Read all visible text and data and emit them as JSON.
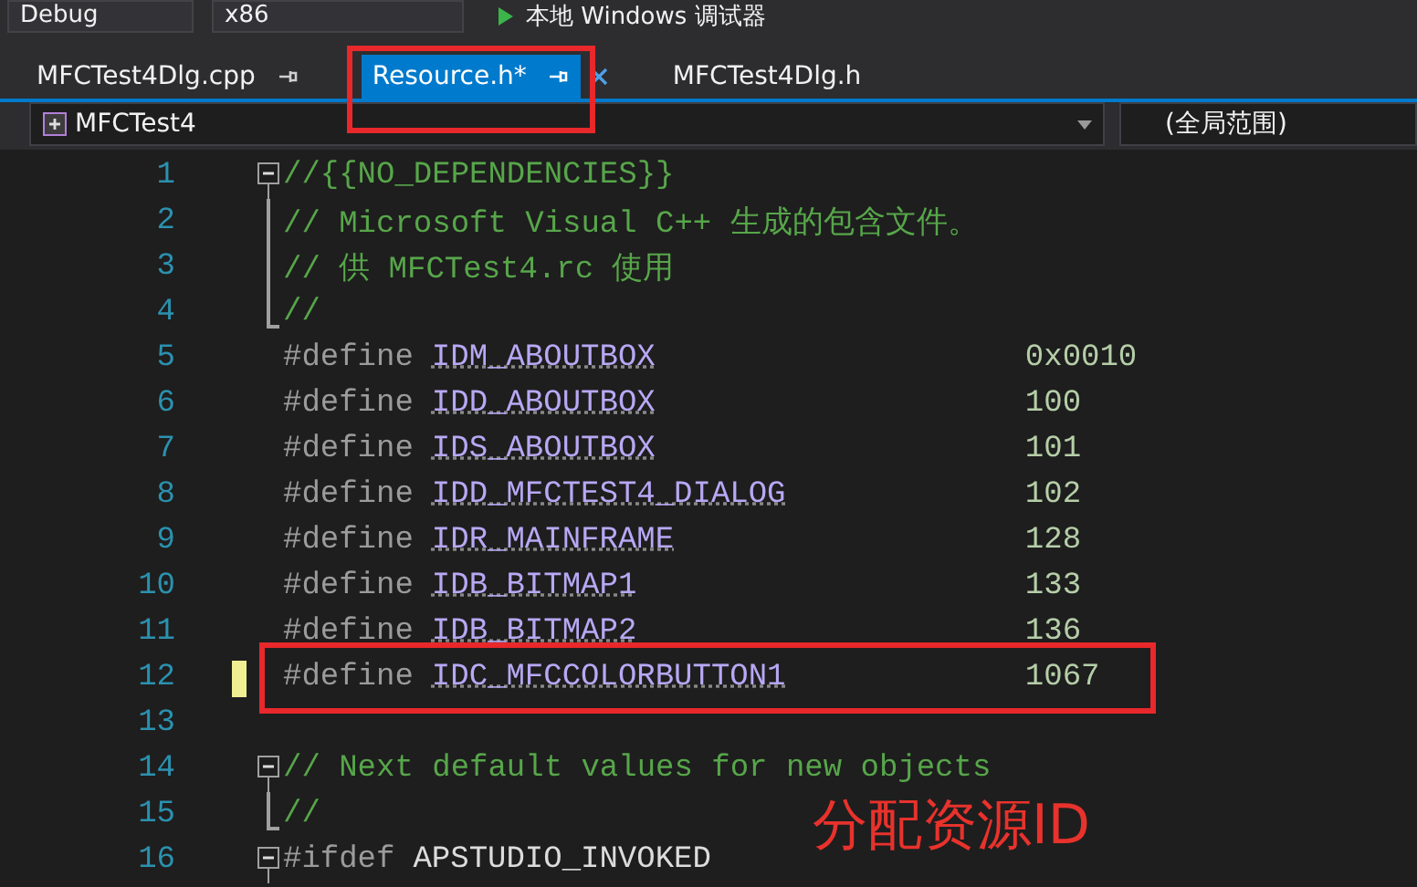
{
  "toolbar": {
    "configuration": "Debug",
    "platform": "x86",
    "debugger": "本地 Windows 调试器"
  },
  "tabs": [
    {
      "label": "MFCTest4Dlg.cpp",
      "selected": false,
      "pinned": true,
      "annotated": false
    },
    {
      "label": "Resource.h*",
      "selected": true,
      "pinned": true,
      "annotated": true
    },
    {
      "label": "MFCTest4Dlg.h",
      "selected": false,
      "pinned": false,
      "annotated": false
    }
  ],
  "navigation": {
    "project": "MFCTest4",
    "scope": "(全局范围)"
  },
  "lines": [
    {
      "number": "1",
      "kind": "comment",
      "fold_start": true,
      "text": "//{{NO_DEPENDENCIES}}"
    },
    {
      "number": "2",
      "kind": "comment",
      "fold_body": true,
      "text": "// Microsoft Visual C++ 生成的包含文件。"
    },
    {
      "number": "3",
      "kind": "comment",
      "fold_body": true,
      "text": "// 供 MFCTest4.rc 使用"
    },
    {
      "number": "4",
      "kind": "comment",
      "fold_end": true,
      "text": "//"
    },
    {
      "number": "5",
      "kind": "define",
      "keyword": "#define",
      "name": "IDM_ABOUTBOX",
      "value": "0x0010"
    },
    {
      "number": "6",
      "kind": "define",
      "keyword": "#define",
      "name": "IDD_ABOUTBOX",
      "value": "100"
    },
    {
      "number": "7",
      "kind": "define",
      "keyword": "#define",
      "name": "IDS_ABOUTBOX",
      "value": "101"
    },
    {
      "number": "8",
      "kind": "define",
      "keyword": "#define",
      "name": "IDD_MFCTEST4_DIALOG",
      "value": "102"
    },
    {
      "number": "9",
      "kind": "define",
      "keyword": "#define",
      "name": "IDR_MAINFRAME",
      "value": "128"
    },
    {
      "number": "10",
      "kind": "define",
      "keyword": "#define",
      "name": "IDB_BITMAP1",
      "value": "133"
    },
    {
      "number": "11",
      "kind": "define",
      "keyword": "#define",
      "name": "IDB_BITMAP2",
      "value": "136"
    },
    {
      "number": "12",
      "kind": "define",
      "keyword": "#define",
      "name": "IDC_MFCCOLORBUTTON1",
      "value": "1067",
      "modified": true,
      "annotated": true
    },
    {
      "number": "13",
      "kind": "blank"
    },
    {
      "number": "14",
      "kind": "comment",
      "fold_start": true,
      "text": "// Next default values for new objects"
    },
    {
      "number": "15",
      "kind": "comment",
      "fold_end": true,
      "text": "//"
    },
    {
      "number": "16",
      "kind": "ifdef",
      "fold_start": true,
      "keyword": "#ifdef",
      "name": "APSTUDIO_INVOKED"
    }
  ],
  "annotation": "分配资源ID"
}
